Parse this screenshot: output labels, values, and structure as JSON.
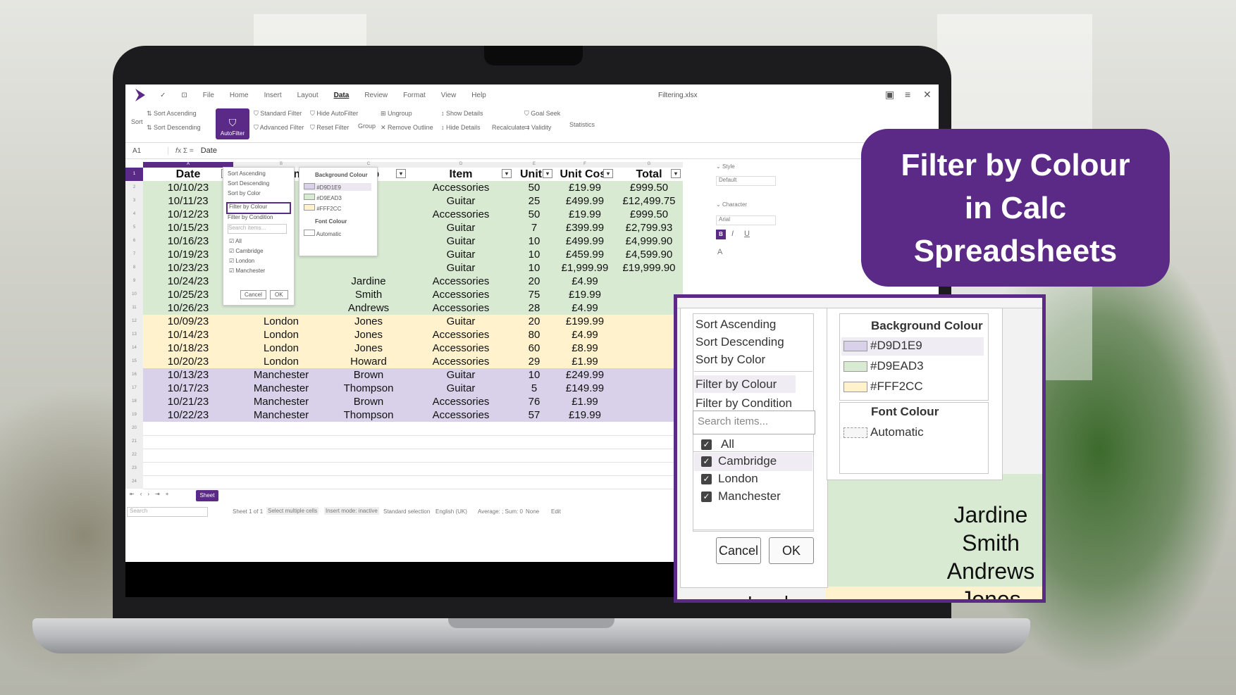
{
  "banner": {
    "line1": "Filter by Colour",
    "line2": "in Calc",
    "line3": "Spreadsheets"
  },
  "app": {
    "menu": [
      "File",
      "Home",
      "Insert",
      "Layout",
      "Data",
      "Review",
      "Format",
      "View",
      "Help"
    ],
    "active_menu": "Data",
    "filename": "Filtering.xlsx",
    "ribbon": {
      "sort": "Sort",
      "sort_asc": "Sort Ascending",
      "sort_desc": "Sort Descending",
      "autofilter": "AutoFilter",
      "standard_filter": "Standard Filter",
      "advanced_filter": "Advanced Filter",
      "hide_autofilter": "Hide AutoFilter",
      "reset_filter": "Reset Filter",
      "group": "Group",
      "ungroup": "Ungroup",
      "remove_outline": "Remove Outline",
      "show_details": "Show Details",
      "hide_details": "Hide Details",
      "recalculate": "Recalculate",
      "goal_seek": "Goal Seek",
      "validity": "Validity",
      "statistics": "Statistics"
    },
    "formula": {
      "cellref": "A1",
      "content": "Date"
    },
    "sidebar": {
      "style": "Style",
      "style_value": "Default",
      "character": "Character",
      "font": "Arial"
    },
    "status": {
      "sheet_tab": "Sheet",
      "search": "Search",
      "sheet_of": "Sheet 1 of 1",
      "select": "Select multiple cells",
      "insert_mode": "Insert mode: inactive",
      "selection": "Standard selection",
      "language": "English (UK)",
      "average": "Average: ; Sum: 0",
      "none": "None",
      "edit": "Edit"
    }
  },
  "table": {
    "headers": [
      "Date",
      "Region",
      "Rep",
      "Item",
      "Units",
      "Unit Cost",
      "Total"
    ],
    "col_letters": [
      "A",
      "B",
      "C",
      "D",
      "E",
      "F",
      "G"
    ],
    "rows": [
      {
        "date": "10/10/23",
        "region": "",
        "rep": "",
        "item": "Accessories",
        "units": "50",
        "cost": "£19.99",
        "total": "£999.50",
        "bg": "#D9EAD3"
      },
      {
        "date": "10/11/23",
        "region": "",
        "rep": "",
        "item": "Guitar",
        "units": "25",
        "cost": "£499.99",
        "total": "£12,499.75",
        "bg": "#D9EAD3"
      },
      {
        "date": "10/12/23",
        "region": "",
        "rep": "",
        "item": "Accessories",
        "units": "50",
        "cost": "£19.99",
        "total": "£999.50",
        "bg": "#D9EAD3"
      },
      {
        "date": "10/15/23",
        "region": "",
        "rep": "",
        "item": "Guitar",
        "units": "7",
        "cost": "£399.99",
        "total": "£2,799.93",
        "bg": "#D9EAD3"
      },
      {
        "date": "10/16/23",
        "region": "",
        "rep": "",
        "item": "Guitar",
        "units": "10",
        "cost": "£499.99",
        "total": "£4,999.90",
        "bg": "#D9EAD3"
      },
      {
        "date": "10/19/23",
        "region": "",
        "rep": "",
        "item": "Guitar",
        "units": "10",
        "cost": "£459.99",
        "total": "£4,599.90",
        "bg": "#D9EAD3"
      },
      {
        "date": "10/23/23",
        "region": "",
        "rep": "",
        "item": "Guitar",
        "units": "10",
        "cost": "£1,999.99",
        "total": "£19,999.90",
        "bg": "#D9EAD3"
      },
      {
        "date": "10/24/23",
        "region": "",
        "rep": "Jardine",
        "item": "Accessories",
        "units": "20",
        "cost": "£4.99",
        "total": "",
        "bg": "#D9EAD3"
      },
      {
        "date": "10/25/23",
        "region": "",
        "rep": "Smith",
        "item": "Accessories",
        "units": "75",
        "cost": "£19.99",
        "total": "",
        "bg": "#D9EAD3"
      },
      {
        "date": "10/26/23",
        "region": "",
        "rep": "Andrews",
        "item": "Accessories",
        "units": "28",
        "cost": "£4.99",
        "total": "",
        "bg": "#D9EAD3"
      },
      {
        "date": "10/09/23",
        "region": "London",
        "rep": "Jones",
        "item": "Guitar",
        "units": "20",
        "cost": "£199.99",
        "total": "",
        "bg": "#FFF2CC"
      },
      {
        "date": "10/14/23",
        "region": "London",
        "rep": "Jones",
        "item": "Accessories",
        "units": "80",
        "cost": "£4.99",
        "total": "",
        "bg": "#FFF2CC"
      },
      {
        "date": "10/18/23",
        "region": "London",
        "rep": "Jones",
        "item": "Accessories",
        "units": "60",
        "cost": "£8.99",
        "total": "",
        "bg": "#FFF2CC"
      },
      {
        "date": "10/20/23",
        "region": "London",
        "rep": "Howard",
        "item": "Accessories",
        "units": "29",
        "cost": "£1.99",
        "total": "",
        "bg": "#FFF2CC"
      },
      {
        "date": "10/13/23",
        "region": "Manchester",
        "rep": "Brown",
        "item": "Guitar",
        "units": "10",
        "cost": "£249.99",
        "total": "",
        "bg": "#D9D1E9"
      },
      {
        "date": "10/17/23",
        "region": "Manchester",
        "rep": "Thompson",
        "item": "Guitar",
        "units": "5",
        "cost": "£149.99",
        "total": "",
        "bg": "#D9D1E9"
      },
      {
        "date": "10/21/23",
        "region": "Manchester",
        "rep": "Brown",
        "item": "Accessories",
        "units": "76",
        "cost": "£1.99",
        "total": "",
        "bg": "#D9D1E9"
      },
      {
        "date": "10/22/23",
        "region": "Manchester",
        "rep": "Thompson",
        "item": "Accessories",
        "units": "57",
        "cost": "£19.99",
        "total": "",
        "bg": "#D9D1E9"
      }
    ]
  },
  "filter_menu": {
    "sort_asc": "Sort Ascending",
    "sort_desc": "Sort Descending",
    "sort_color": "Sort by Color",
    "filter_colour": "Filter by Colour",
    "filter_condition": "Filter by Condition",
    "search_placeholder": "Search items...",
    "items": [
      "All",
      "Cambridge",
      "London",
      "Manchester"
    ],
    "cancel": "Cancel",
    "ok": "OK",
    "bg_title": "Background Colour",
    "colours": [
      {
        "hex": "#D9D1E9"
      },
      {
        "hex": "#D9EAD3"
      },
      {
        "hex": "#FFF2CC"
      }
    ],
    "font_title": "Font Colour",
    "font_auto": "Automatic"
  },
  "zoom_bg": {
    "names": [
      "Jardine",
      "Smith",
      "Andrews",
      "Jones"
    ],
    "region_partial": "London"
  },
  "colors": {
    "purple": "#5B2A86",
    "green": "#D9EAD3",
    "yellow": "#FFF2CC",
    "lavender": "#D9D1E9"
  }
}
